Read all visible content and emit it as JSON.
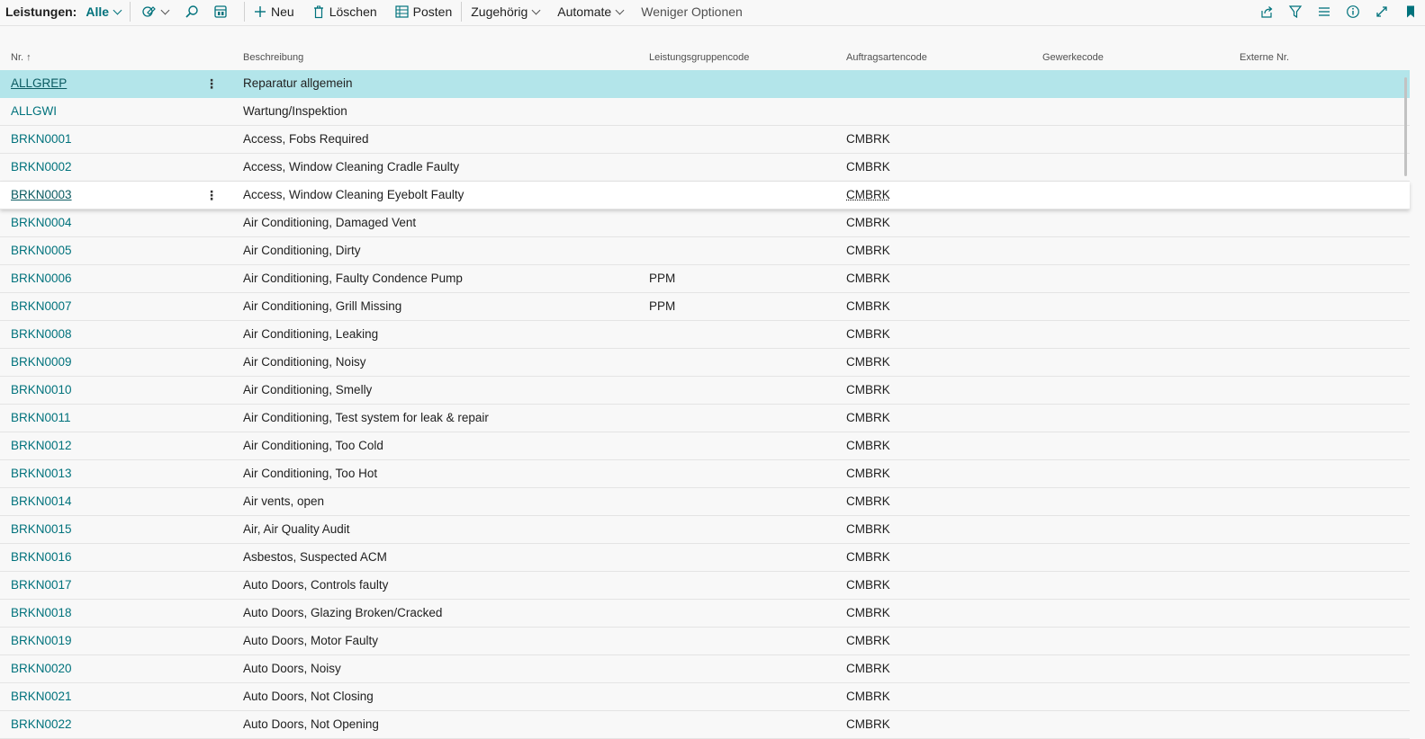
{
  "toolbar": {
    "title": "Leistungen:",
    "filter": "Alle",
    "new_label": "Neu",
    "delete_label": "Löschen",
    "entries_label": "Posten",
    "related_label": "Zugehörig",
    "automate_label": "Automate",
    "fewer_options_label": "Weniger Optionen"
  },
  "icons": {
    "left": [
      "edit-view-icon",
      "search-icon",
      "analyze-icon"
    ],
    "right": [
      "share-icon",
      "filter-icon",
      "list-view-icon",
      "info-icon",
      "expand-icon",
      "bookmark-icon"
    ]
  },
  "colors": {
    "accent": "#00727c",
    "selected_row": "#b3e5ea"
  },
  "columns": {
    "nr": "Nr. ↑",
    "beschreibung": "Beschreibung",
    "leistungsgruppencode": "Leistungsgruppencode",
    "auftragsartencode": "Auftragsartencode",
    "gewerkecode": "Gewerkecode",
    "externe_nr": "Externe Nr."
  },
  "rows": [
    {
      "nr": "ALLGREP",
      "beschreibung": "Reparatur allgemein",
      "lgc": "",
      "aac": "",
      "state": "selected"
    },
    {
      "nr": "ALLGWI",
      "beschreibung": "Wartung/Inspektion",
      "lgc": "",
      "aac": ""
    },
    {
      "nr": "BRKN0001",
      "beschreibung": "Access, Fobs Required",
      "lgc": "",
      "aac": "CMBRK"
    },
    {
      "nr": "BRKN0002",
      "beschreibung": "Access, Window Cleaning Cradle Faulty",
      "lgc": "",
      "aac": "CMBRK"
    },
    {
      "nr": "BRKN0003",
      "beschreibung": "Access, Window Cleaning Eyebolt Faulty",
      "lgc": "",
      "aac": "CMBRK",
      "state": "focused"
    },
    {
      "nr": "BRKN0004",
      "beschreibung": "Air Conditioning, Damaged Vent",
      "lgc": "",
      "aac": "CMBRK"
    },
    {
      "nr": "BRKN0005",
      "beschreibung": "Air Conditioning, Dirty",
      "lgc": "",
      "aac": "CMBRK"
    },
    {
      "nr": "BRKN0006",
      "beschreibung": "Air Conditioning, Faulty Condence Pump",
      "lgc": "PPM",
      "aac": "CMBRK"
    },
    {
      "nr": "BRKN0007",
      "beschreibung": "Air Conditioning, Grill Missing",
      "lgc": "PPM",
      "aac": "CMBRK"
    },
    {
      "nr": "BRKN0008",
      "beschreibung": "Air Conditioning, Leaking",
      "lgc": "",
      "aac": "CMBRK"
    },
    {
      "nr": "BRKN0009",
      "beschreibung": "Air Conditioning, Noisy",
      "lgc": "",
      "aac": "CMBRK"
    },
    {
      "nr": "BRKN0010",
      "beschreibung": "Air Conditioning, Smelly",
      "lgc": "",
      "aac": "CMBRK"
    },
    {
      "nr": "BRKN0011",
      "beschreibung": "Air Conditioning, Test system for leak & repair",
      "lgc": "",
      "aac": "CMBRK"
    },
    {
      "nr": "BRKN0012",
      "beschreibung": "Air Conditioning, Too Cold",
      "lgc": "",
      "aac": "CMBRK"
    },
    {
      "nr": "BRKN0013",
      "beschreibung": "Air Conditioning, Too Hot",
      "lgc": "",
      "aac": "CMBRK"
    },
    {
      "nr": "BRKN0014",
      "beschreibung": "Air vents, open",
      "lgc": "",
      "aac": "CMBRK"
    },
    {
      "nr": "BRKN0015",
      "beschreibung": "Air, Air Quality Audit",
      "lgc": "",
      "aac": "CMBRK"
    },
    {
      "nr": "BRKN0016",
      "beschreibung": "Asbestos, Suspected ACM",
      "lgc": "",
      "aac": "CMBRK"
    },
    {
      "nr": "BRKN0017",
      "beschreibung": "Auto Doors, Controls faulty",
      "lgc": "",
      "aac": "CMBRK"
    },
    {
      "nr": "BRKN0018",
      "beschreibung": "Auto Doors, Glazing Broken/Cracked",
      "lgc": "",
      "aac": "CMBRK"
    },
    {
      "nr": "BRKN0019",
      "beschreibung": "Auto Doors, Motor Faulty",
      "lgc": "",
      "aac": "CMBRK"
    },
    {
      "nr": "BRKN0020",
      "beschreibung": "Auto Doors, Noisy",
      "lgc": "",
      "aac": "CMBRK"
    },
    {
      "nr": "BRKN0021",
      "beschreibung": "Auto Doors, Not Closing",
      "lgc": "",
      "aac": "CMBRK"
    },
    {
      "nr": "BRKN0022",
      "beschreibung": "Auto Doors, Not Opening",
      "lgc": "",
      "aac": "CMBRK"
    }
  ]
}
